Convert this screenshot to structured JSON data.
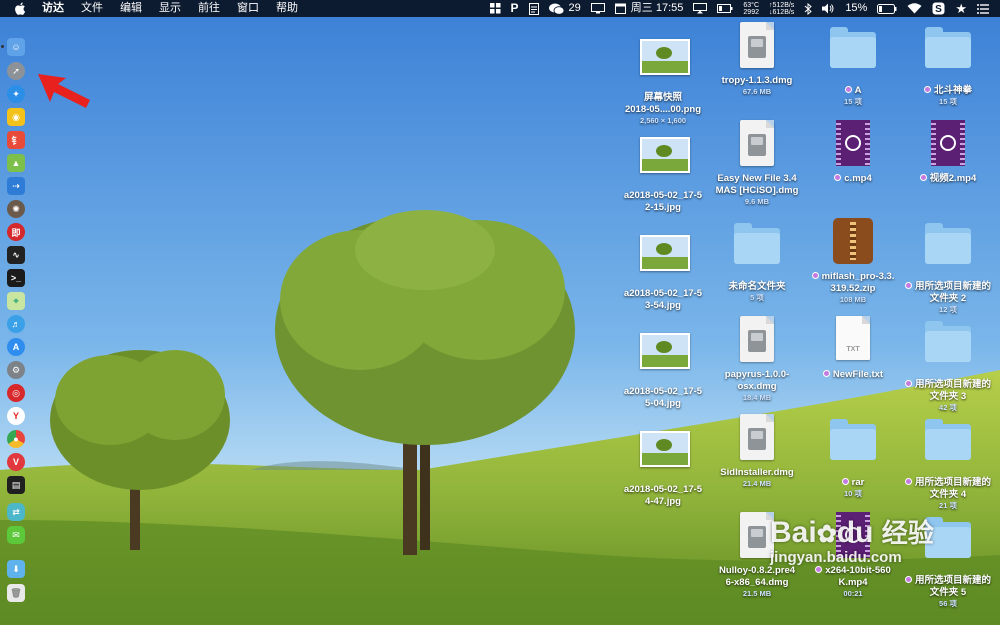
{
  "menubar": {
    "app": "访达",
    "items": [
      "文件",
      "编辑",
      "显示",
      "前往",
      "窗口",
      "帮助"
    ],
    "status": {
      "wechat_count": "29",
      "date_time": "周三 17:55",
      "cpu_temp": "63°C",
      "cpu_fan": "2992",
      "net_up": "↑512B/s",
      "net_down": "↓612B/s",
      "battery": "15%"
    }
  },
  "desktop": {
    "col1": [
      {
        "name": "屏幕快照\n2018-05....00.png",
        "meta": "2,560 × 1,600",
        "kind": "png"
      },
      {
        "name": "a2018-05-02_17-5\n2-15.jpg",
        "meta": "",
        "kind": "png"
      },
      {
        "name": "a2018-05-02_17-5\n3-54.jpg",
        "meta": "",
        "kind": "png"
      },
      {
        "name": "a2018-05-02_17-5\n5-04.jpg",
        "meta": "",
        "kind": "png"
      },
      {
        "name": "a2018-05-02_17-5\n4-47.jpg",
        "meta": "",
        "kind": "png"
      }
    ],
    "col2": [
      {
        "name": "tropy-1.1.3.dmg",
        "meta": "67.6 MB",
        "kind": "dmg"
      },
      {
        "name": "Easy New File 3.4\nMAS [HCiSO].dmg",
        "meta": "9.6 MB",
        "kind": "dmg"
      },
      {
        "name": "未命名文件夹",
        "meta": "5 项",
        "kind": "folder"
      },
      {
        "name": "papyrus-1.0.0-\nosx.dmg",
        "meta": "18.4 MB",
        "kind": "dmg"
      },
      {
        "name": "SidInstaller.dmg",
        "meta": "21.4 MB",
        "kind": "dmg"
      },
      {
        "name": "Nulloy-0.8.2.pre4\n6-x86_64.dmg",
        "meta": "21.5 MB",
        "kind": "dmg"
      }
    ],
    "col3": [
      {
        "name": "A",
        "meta": "15 项",
        "kind": "folder",
        "tag": true
      },
      {
        "name": "c.mp4",
        "meta": "",
        "kind": "mp4",
        "tag": true
      },
      {
        "name": "miflash_pro-3.3.\n319.52.zip",
        "meta": "108 MB",
        "kind": "zip",
        "tag": true
      },
      {
        "name": "NewFile.txt",
        "meta": "",
        "kind": "txt",
        "tag": true
      },
      {
        "name": "rar",
        "meta": "10 项",
        "kind": "folder",
        "tag": true
      },
      {
        "name": "x264-10bit-560\nK.mp4",
        "meta": "00:21",
        "kind": "mp4",
        "tag": true
      }
    ],
    "col4": [
      {
        "name": "北斗神拳",
        "meta": "15 项",
        "kind": "folder",
        "tag": true
      },
      {
        "name": "视频2.mp4",
        "meta": "",
        "kind": "mp4",
        "tag": true
      },
      {
        "name": "用所选项目新建的\n文件夹 2",
        "meta": "12 项",
        "kind": "folder",
        "tag": true
      },
      {
        "name": "用所选项目新建的\n文件夹 3",
        "meta": "42 项",
        "kind": "folder",
        "tag": true
      },
      {
        "name": "用所选项目新建的\n文件夹 4",
        "meta": "21 项",
        "kind": "folder",
        "tag": true
      },
      {
        "name": "用所选项目新建的\n文件夹 5",
        "meta": "56 项",
        "kind": "folder",
        "tag": true
      }
    ]
  },
  "watermark": {
    "brand": "Bai",
    "brand2": "du",
    "cn": "经验",
    "url": "jingyan.baidu.com"
  }
}
